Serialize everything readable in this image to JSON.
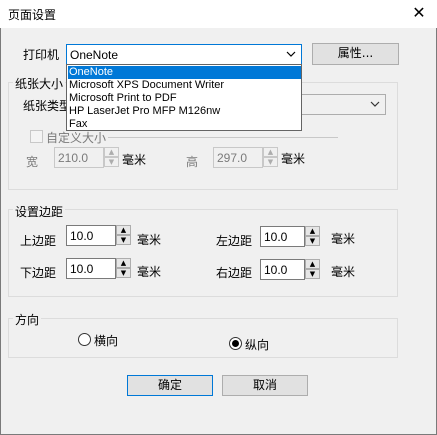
{
  "window": {
    "title": "页面设置",
    "close_glyph": "✕"
  },
  "printer": {
    "label": "打印机",
    "selected": "OneNote",
    "properties_button": "属性...",
    "options": [
      "OneNote",
      "Microsoft XPS Document Writer",
      "Microsoft Print to PDF",
      "HP LaserJet Pro MFP M126nw",
      "Fax"
    ]
  },
  "paper": {
    "group_label": "纸张大小",
    "type_label": "纸张类型",
    "custom_label": "自定义大小",
    "width_label": "宽",
    "width_value": "210.0",
    "width_unit": "毫米",
    "height_label": "高",
    "height_value": "297.0",
    "height_unit": "毫米"
  },
  "margins": {
    "group_label": "设置边距",
    "top_label": "上边距",
    "top_value": "10.0",
    "top_unit": "毫米",
    "left_label": "左边距",
    "left_value": "10.0",
    "left_unit": "毫米",
    "bottom_label": "下边距",
    "bottom_value": "10.0",
    "bottom_unit": "毫米",
    "right_label": "右边距",
    "right_value": "10.0",
    "right_unit": "毫米"
  },
  "orientation": {
    "group_label": "方向",
    "landscape_label": "横向",
    "portrait_label": "纵向",
    "selected": "portrait"
  },
  "buttons": {
    "ok": "确定",
    "cancel": "取消"
  }
}
